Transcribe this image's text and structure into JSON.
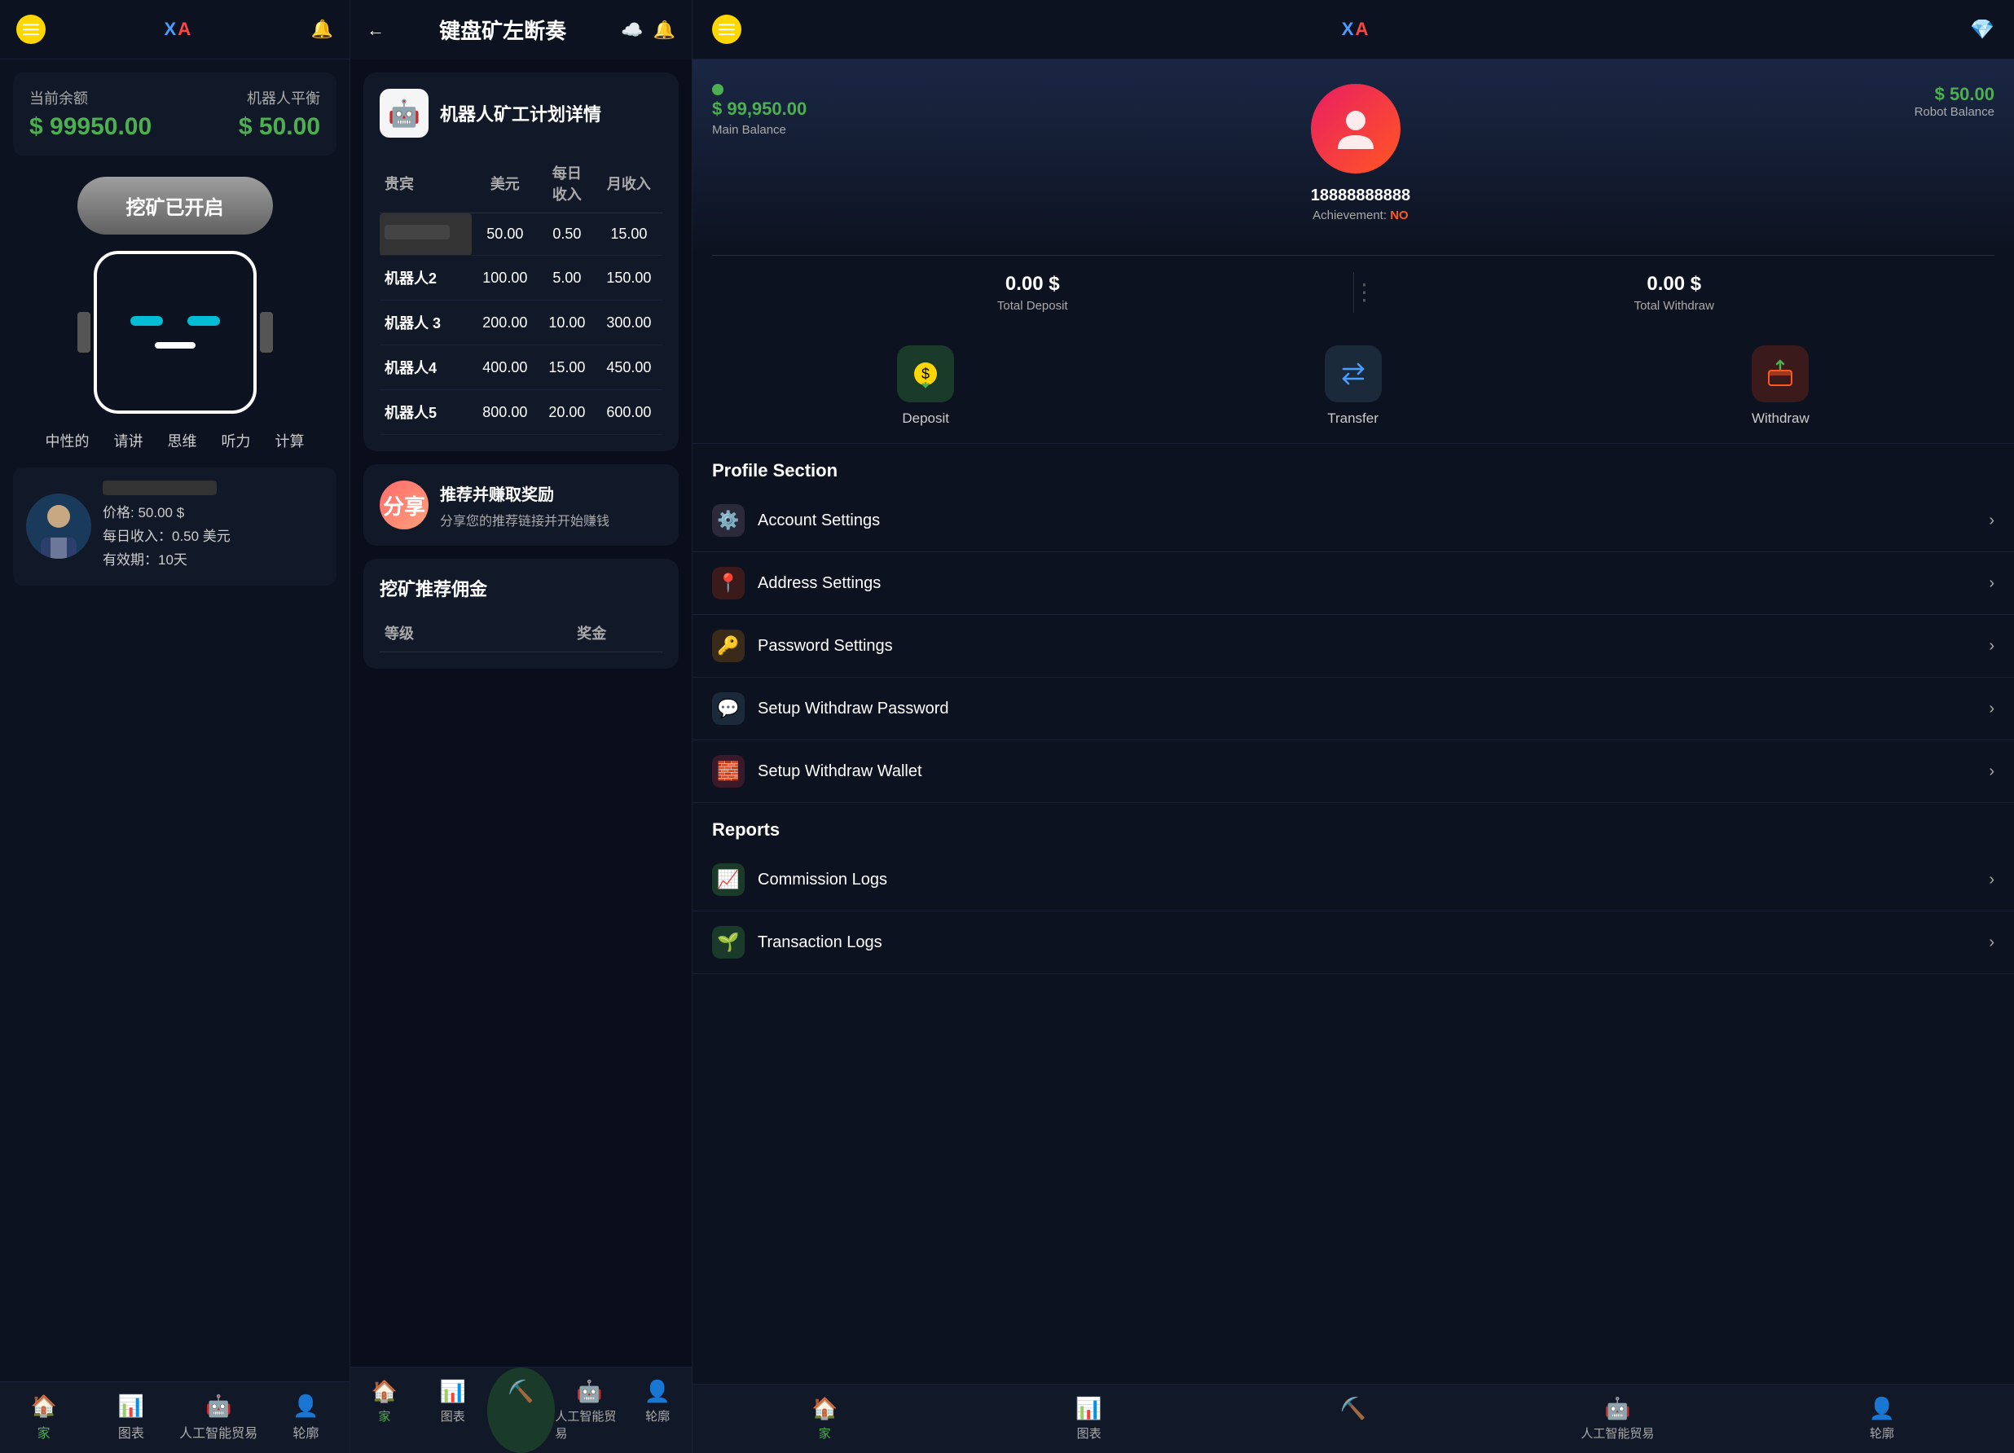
{
  "panel1": {
    "header": {
      "logo": "XA"
    },
    "balance": {
      "current_label": "当前余额",
      "current_amount": "$ 99950.00",
      "robot_label": "机器人平衡",
      "robot_amount": "$ 50.00"
    },
    "mining_button": "挖矿已开启",
    "robot_tags": [
      "中性的",
      "请讲",
      "思维",
      "听力",
      "计算"
    ],
    "robot_card": {
      "price": "价格: 50.00 $",
      "daily": "每日收入：0.50 美元",
      "period": "有效期：10天"
    },
    "nav": [
      {
        "label": "家",
        "icon": "🏠",
        "active": true
      },
      {
        "label": "图表",
        "icon": "📊",
        "active": false
      },
      {
        "label": "人工智能贸易",
        "icon": "🤖",
        "active": false
      },
      {
        "label": "轮廓",
        "icon": "👤",
        "active": false
      }
    ]
  },
  "panel2": {
    "header": {
      "title": "键盘矿左断奏"
    },
    "mining_plan": {
      "title": "机器人矿工计划详情",
      "icon": "🤖",
      "columns": [
        "贵宾",
        "美元",
        "每日收入",
        "月收入"
      ],
      "rows": [
        {
          "name": "blurred",
          "usd": "50.00",
          "daily": "0.50",
          "monthly": "15.00"
        },
        {
          "name": "机器人2",
          "usd": "100.00",
          "daily": "5.00",
          "monthly": "150.00"
        },
        {
          "name": "机器人 3",
          "usd": "200.00",
          "daily": "10.00",
          "monthly": "300.00"
        },
        {
          "name": "机器人4",
          "usd": "400.00",
          "daily": "15.00",
          "monthly": "450.00"
        },
        {
          "name": "机器人5",
          "usd": "800.00",
          "daily": "20.00",
          "monthly": "600.00"
        }
      ]
    },
    "referral": {
      "icon_text": "分享",
      "title": "推荐并赚取奖励",
      "subtitle": "分享您的推荐链接并开始赚钱"
    },
    "commission": {
      "title": "挖矿推荐佣金",
      "columns": [
        "等级",
        "奖金"
      ]
    },
    "nav": [
      {
        "label": "家",
        "icon": "🏠",
        "active": true
      },
      {
        "label": "图表",
        "icon": "📊",
        "active": false
      },
      {
        "label": "人工智能贸易",
        "icon": "🤖",
        "active": false
      },
      {
        "label": "轮廓",
        "icon": "👤",
        "active": false
      }
    ]
  },
  "panel3": {
    "header": {
      "logo": "XA"
    },
    "profile": {
      "username": "18888888888",
      "achievement_label": "Achievement:",
      "achievement_value": "NO",
      "main_balance": "$ 99,950.00",
      "main_balance_label": "Main Balance",
      "robot_balance": "$ 50.00",
      "robot_balance_label": "Robot Balance",
      "total_deposit": "0.00 $",
      "total_deposit_label": "Total Deposit",
      "total_withdraw": "0.00 $",
      "total_withdraw_label": "Total Withdraw"
    },
    "actions": [
      {
        "label": "Deposit",
        "type": "deposit"
      },
      {
        "label": "Transfer",
        "type": "transfer"
      },
      {
        "label": "Withdraw",
        "type": "withdraw"
      }
    ],
    "profile_section_title": "Profile Section",
    "profile_menu": [
      {
        "label": "Account Settings",
        "icon": "⚙️",
        "icon_bg": "#2a2a3a"
      },
      {
        "label": "Address Settings",
        "icon": "📍",
        "icon_bg": "#3a1a1a"
      },
      {
        "label": "Password Settings",
        "icon": "🔑",
        "icon_bg": "#3a2a1a"
      },
      {
        "label": "Setup Withdraw Password",
        "icon": "💬",
        "icon_bg": "#1a2a3a"
      },
      {
        "label": "Setup Withdraw Wallet",
        "icon": "🧱",
        "icon_bg": "#3a1a2a"
      }
    ],
    "reports_section_title": "Reports",
    "reports_menu": [
      {
        "label": "Commission Logs",
        "icon": "📈",
        "icon_bg": "#1a3a2a"
      },
      {
        "label": "Transaction Logs",
        "icon": "🌱",
        "icon_bg": "#1a3a2a"
      }
    ],
    "nav": [
      {
        "label": "家",
        "icon": "🏠",
        "active": true
      },
      {
        "label": "图表",
        "icon": "📊",
        "active": false
      },
      {
        "label": "人工智能贸易",
        "icon": "🤖",
        "active": false
      },
      {
        "label": "轮廓",
        "icon": "👤",
        "active": false
      }
    ]
  }
}
